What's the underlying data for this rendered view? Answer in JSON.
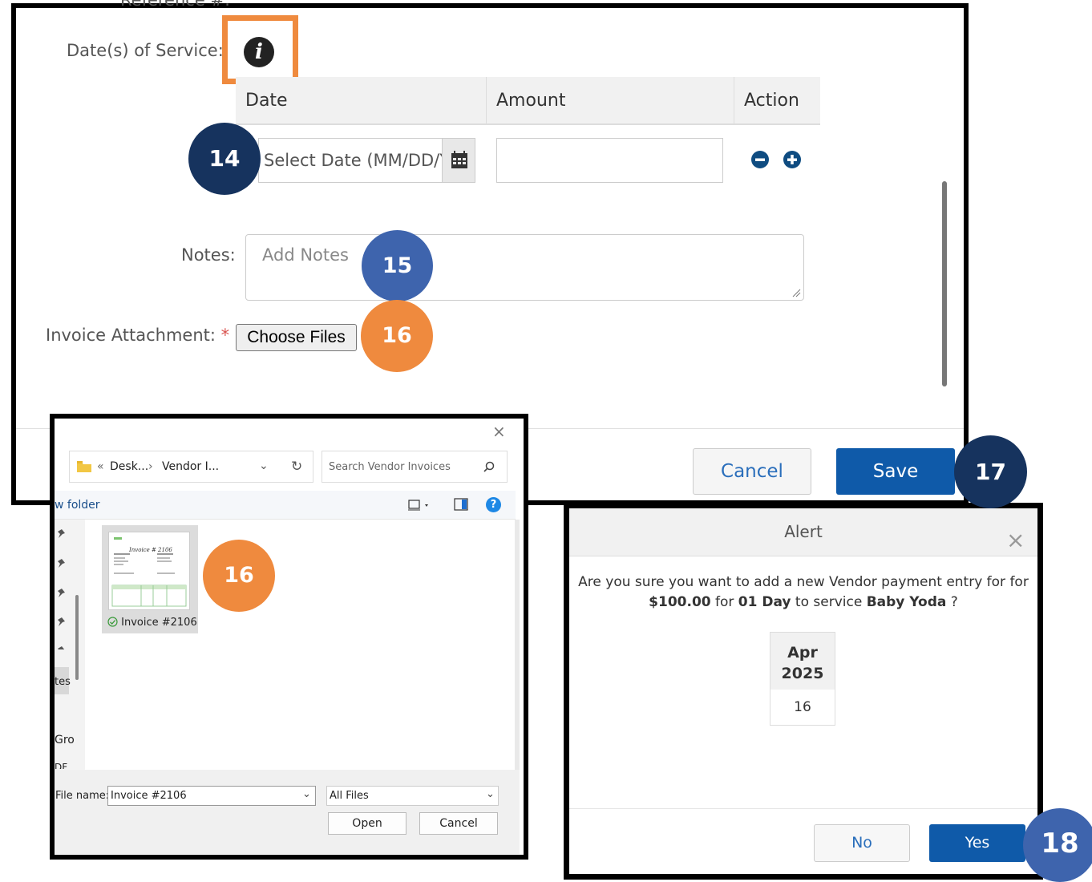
{
  "form": {
    "top_cut_label": "Reference #:",
    "dates_label": "Date(s) of Service:",
    "required_mark": "*",
    "info_icon_glyph": "i",
    "columns": [
      "Date",
      "Amount",
      "Action"
    ],
    "date_placeholder": "Select Date (MM/DD/YYYY)",
    "amount_value": "",
    "notes_label": "Notes:",
    "notes_placeholder": "Add Notes",
    "attachment_label": "Invoice Attachment:",
    "choose_files_label": "Choose Files",
    "cancel_label": "Cancel",
    "save_label": "Save"
  },
  "steps": {
    "s14": "14",
    "s15": "15",
    "s16a": "16",
    "s16b": "16",
    "s17": "17",
    "s18": "18"
  },
  "file_dialog": {
    "breadcrumb_1": "Desk...",
    "breadcrumb_2": "Vendor I...",
    "search_placeholder": "Search Vendor Invoices",
    "new_folder_label": "w folder",
    "nav_partial_1": "tes",
    "nav_partial_2": "Gro",
    "nav_partial_3": "DF",
    "file_name": "Invoice #2106",
    "thumb_title": "Invoice # 2106",
    "file_name_label": "File name:",
    "file_name_value": "Invoice #2106",
    "file_type": "All Files",
    "open_label": "Open",
    "cancel_label": "Cancel"
  },
  "alert": {
    "title": "Alert",
    "close_glyph": "×",
    "msg_line1": "Are you sure you want to add a new Vendor payment entry for for",
    "amount": "$100.00",
    "word_for": "for",
    "days": "01 Day",
    "word_to_service": "to service",
    "child": "Baby Yoda",
    "qmark": "?",
    "month": "Apr",
    "year": "2025",
    "day": "16",
    "no_label": "No",
    "yes_label": "Yes"
  },
  "colors": {
    "accent_orange": "#ef8a3e",
    "navy": "#16335e",
    "step_blue": "#3e64ad",
    "primary_button": "#0f5aa9"
  }
}
